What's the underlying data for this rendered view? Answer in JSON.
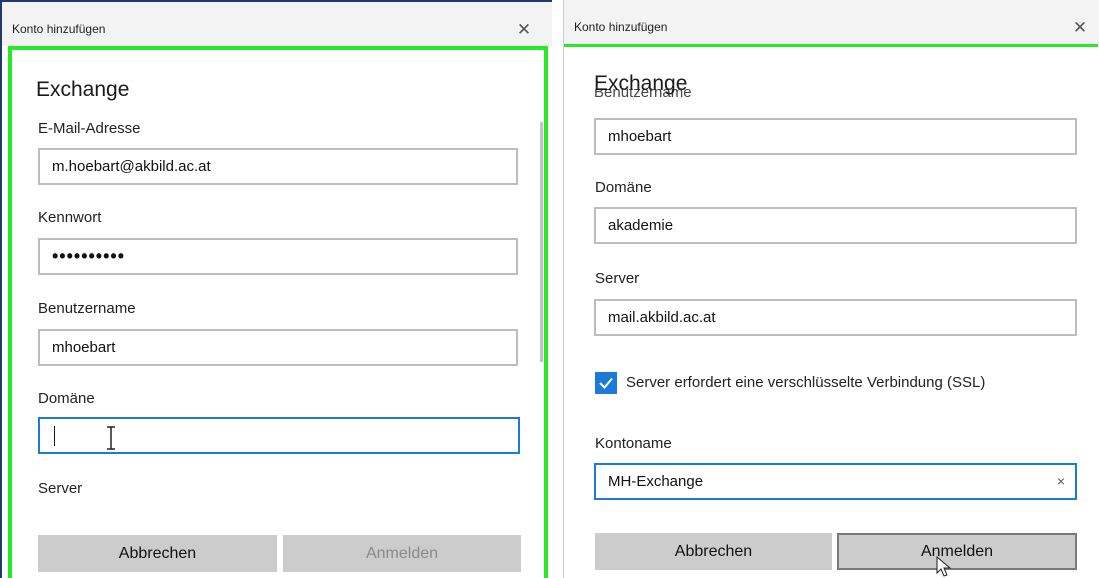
{
  "left": {
    "window_title": "Konto hinzufügen",
    "close_glyph": "✕",
    "heading": "Exchange",
    "fields": {
      "email": {
        "label": "E-Mail-Adresse",
        "value": "m.hoebart@akbild.ac.at"
      },
      "password": {
        "label": "Kennwort",
        "value": "••••••••••"
      },
      "username": {
        "label": "Benutzername",
        "value": "mhoebart"
      },
      "domain": {
        "label": "Domäne",
        "value": ""
      },
      "server": {
        "label": "Server"
      }
    },
    "buttons": {
      "cancel": "Abbrechen",
      "signin": "Anmelden"
    },
    "cursor_icon": "text-cursor-icon"
  },
  "right": {
    "window_title": "Konto hinzufügen",
    "close_glyph": "✕",
    "heading": "Exchange",
    "clipped_label": "Benutzername",
    "fields": {
      "username": {
        "value": "mhoebart"
      },
      "domain": {
        "label": "Domäne",
        "value": "akademie"
      },
      "server": {
        "label": "Server",
        "value": "mail.akbild.ac.at"
      },
      "ssl": {
        "label": "Server erfordert eine verschlüsselte Verbindung (SSL)",
        "checked": true
      },
      "account_name": {
        "label": "Kontoname",
        "value": "MH-Exchange",
        "clear_glyph": "×"
      }
    },
    "buttons": {
      "cancel": "Abbrechen",
      "signin": "Anmelden"
    },
    "cursor_icon": "pointer-cursor-icon"
  },
  "colors": {
    "accent": "#1c7ad8",
    "highlight": "#27ea27",
    "button": "#cccccc"
  }
}
